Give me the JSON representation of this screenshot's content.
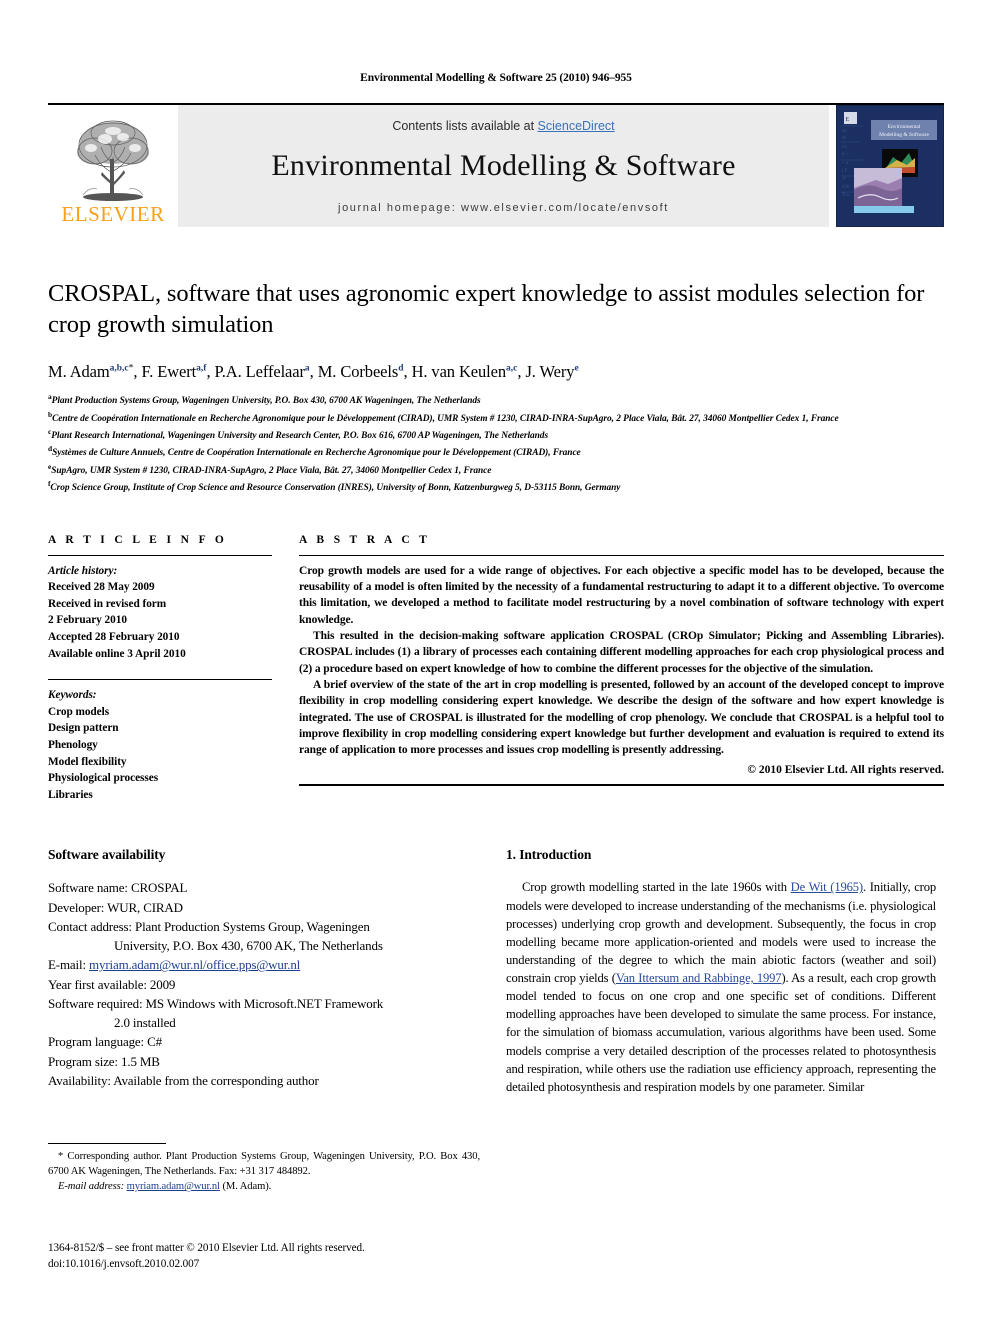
{
  "running_head": "Environmental Modelling & Software 25 (2010) 946–955",
  "masthead": {
    "publisher_name": "ELSEVIER",
    "contents_prefix": "Contents lists available at ",
    "sciencedirect": "ScienceDirect",
    "journal_title": "Environmental Modelling & Software",
    "homepage": "journal homepage: www.elsevier.com/locate/envsoft",
    "cover_title": "Environmental Modelling & Software",
    "accent_orange": "#F5A11B",
    "link_blue": "#3a72b8",
    "band_gray": "#ececec",
    "cover_navy": "#1b2f63"
  },
  "article": {
    "title": "CROSPAL, software that uses agronomic expert knowledge to assist modules selection for crop growth simulation",
    "authors": [
      {
        "name": "M. Adam",
        "sup": "a,b,c",
        "star": true,
        "sep": ", "
      },
      {
        "name": "F. Ewert",
        "sup": "a,f",
        "star": false,
        "sep": ", "
      },
      {
        "name": "P.A. Leffelaar",
        "sup": "a",
        "star": false,
        "sep": ", "
      },
      {
        "name": "M. Corbeels",
        "sup": "d",
        "star": false,
        "sep": ", "
      },
      {
        "name": "H. van Keulen",
        "sup": "a,c",
        "star": false,
        "sep": ", "
      },
      {
        "name": "J. Wery",
        "sup": "e",
        "star": false,
        "sep": ""
      }
    ],
    "affiliations": [
      {
        "mark": "a",
        "text": "Plant Production Systems Group, Wageningen University, P.O. Box 430, 6700 AK Wageningen, The Netherlands"
      },
      {
        "mark": "b",
        "text": "Centre de Coopération Internationale en Recherche Agronomique pour le Développement (CIRAD), UMR System # 1230, CIRAD-INRA-SupAgro, 2 Place Viala, Bât. 27, 34060 Montpellier Cedex 1, France"
      },
      {
        "mark": "c",
        "text": "Plant Research International, Wageningen University and Research Center, P.O. Box 616, 6700 AP Wageningen, The Netherlands"
      },
      {
        "mark": "d",
        "text": "Systèmes de Culture Annuels, Centre de Coopération Internationale en Recherche Agronomique pour le Développement (CIRAD), France"
      },
      {
        "mark": "e",
        "text": "SupAgro, UMR System # 1230, CIRAD-INRA-SupAgro, 2 Place Viala, Bât. 27, 34060 Montpellier Cedex 1, France"
      },
      {
        "mark": "f",
        "text": "Crop Science Group, Institute of Crop Science and Resource Conservation (INRES), University of Bonn, Katzenburgweg 5, D-53115 Bonn, Germany"
      }
    ]
  },
  "article_info": {
    "heading": "A R T I C L E   I N F O",
    "history_label": "Article history:",
    "history": [
      "Received 28 May 2009",
      "Received in revised form",
      "2 February 2010",
      "Accepted 28 February 2010",
      "Available online 3 April 2010"
    ],
    "keywords_label": "Keywords:",
    "keywords": [
      "Crop models",
      "Design pattern",
      "Phenology",
      "Model flexibility",
      "Physiological processes",
      "Libraries"
    ]
  },
  "abstract": {
    "heading": "A B S T R A C T",
    "paragraphs": [
      "Crop growth models are used for a wide range of objectives. For each objective a specific model has to be developed, because the reusability of a model is often limited by the necessity of a fundamental restructuring to adapt it to a different objective. To overcome this limitation, we developed a method to facilitate model restructuring by a novel combination of software technology with expert knowledge.",
      "This resulted in the decision-making software application CROSPAL (CROp Simulator; Picking and Assembling Libraries). CROSPAL includes (1) a library of processes each containing different modelling approaches for each crop physiological process and (2) a procedure based on expert knowledge of how to combine the different processes for the objective of the simulation.",
      "A brief overview of the state of the art in crop modelling is presented, followed by an account of the developed concept to improve flexibility in crop modelling considering expert knowledge. We describe the design of the software and how expert knowledge is integrated. The use of CROSPAL is illustrated for the modelling of crop phenology. We conclude that CROSPAL is a helpful tool to improve flexibility in crop modelling considering expert knowledge but further development and evaluation is required to extend its range of application to more processes and issues crop modelling is presently addressing."
    ],
    "copyright": "© 2010 Elsevier Ltd. All rights reserved."
  },
  "software_availability": {
    "heading": "Software availability",
    "rows": [
      {
        "label": "Software name: ",
        "value": "CROSPAL"
      },
      {
        "label": "Developer: ",
        "value": "WUR, CIRAD"
      },
      {
        "label": "Contact address: ",
        "value": "Plant Production Systems Group, Wageningen"
      },
      {
        "label": "",
        "value": "University, P.O. Box 430, 6700 AK, The Netherlands",
        "continuation": true
      },
      {
        "label": "E-mail: ",
        "value": "myriam.adam@wur.nl/office.pps@wur.nl",
        "link": true
      },
      {
        "label": "Year first available: ",
        "value": "2009"
      },
      {
        "label": "Software required: ",
        "value": "MS Windows with Microsoft.NET Framework"
      },
      {
        "label": "",
        "value": "2.0 installed",
        "continuation": true
      },
      {
        "label": "Program language: ",
        "value": "C#"
      },
      {
        "label": "Program size: ",
        "value": "1.5 MB"
      },
      {
        "label": "Availability: ",
        "value": "Available from the corresponding author"
      }
    ]
  },
  "introduction": {
    "heading": "1. Introduction",
    "paragraph_parts": [
      {
        "t": "Crop growth modelling started in the late 1960s with ",
        "cite": false
      },
      {
        "t": "De Wit (1965)",
        "cite": true
      },
      {
        "t": ". Initially, crop models were developed to increase understanding of the mechanisms (i.e. physiological processes) underlying crop growth and development. Subsequently, the focus in crop modelling became more application-oriented and models were used to increase the understanding of the degree to which the main abiotic factors (weather and soil) constrain crop yields (",
        "cite": false
      },
      {
        "t": "Van Ittersum and Rabbinge, 1997",
        "cite": true
      },
      {
        "t": "). As a result, each crop growth model tended to focus on one crop and one specific set of conditions. Different modelling approaches have been developed to simulate the same process. For instance, for the simulation of biomass accumulation, various algorithms have been used. Some models comprise a very detailed description of the processes related to photosynthesis and respiration, while others use the radiation use efficiency approach, representing the detailed photosynthesis and respiration models by one parameter. Similar",
        "cite": false
      }
    ]
  },
  "footnote": {
    "corresponding": "* Corresponding author. Plant Production Systems Group, Wageningen University, P.O. Box 430, 6700 AK Wageningen, The Netherlands. Fax: +31 317 484892.",
    "email_label": "E-mail address: ",
    "email": "myriam.adam@wur.nl",
    "email_suffix": " (M. Adam)."
  },
  "issn_block": {
    "line1": "1364-8152/$ – see front matter © 2010 Elsevier Ltd. All rights reserved.",
    "line2": "doi:10.1016/j.envsoft.2010.02.007"
  }
}
